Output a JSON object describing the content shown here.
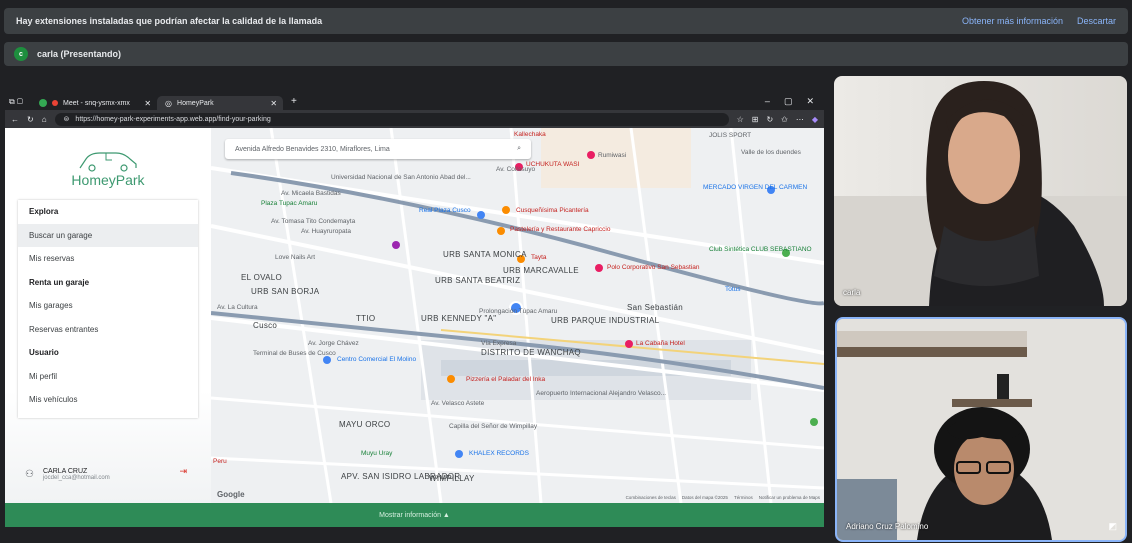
{
  "extension_bar": {
    "message": "Hay extensiones instaladas que podrían afectar la calidad de la llamada",
    "more_info": "Obtener más información",
    "dismiss": "Descartar"
  },
  "presenting_bar": {
    "avatar_letter": "c",
    "label": "carla (Presentando)"
  },
  "browser": {
    "tabs": [
      {
        "label": "Meet - snq-ysmx-xmx",
        "close": "✕"
      },
      {
        "label": "HomeyPark",
        "close": "✕"
      }
    ],
    "new_tab": "+",
    "url": "https://homey-park-experiments-app.web.app/find-your-parking",
    "window_controls": [
      "–",
      "▢",
      "✕"
    ]
  },
  "app": {
    "brand": "HomeyPark",
    "brand_color": "#3d9970",
    "menu": [
      {
        "label": "Explora",
        "type": "header"
      },
      {
        "label": "Buscar un garage",
        "type": "item",
        "selected": true
      },
      {
        "label": "Mis reservas",
        "type": "item"
      },
      {
        "label": "Renta un garaje",
        "type": "header"
      },
      {
        "label": "Mis garages",
        "type": "item"
      },
      {
        "label": "Reservas entrantes",
        "type": "item"
      },
      {
        "label": "Usuario",
        "type": "header"
      },
      {
        "label": "Mi perfil",
        "type": "item"
      },
      {
        "label": "Mis vehículos",
        "type": "item"
      }
    ],
    "user": {
      "name": "CARLA CRUZ",
      "email": "jocdel_cca@hotmail.com"
    },
    "search_value": "Avenida Alfredo Benavides 2310, Miraflores, Lima",
    "show_info": "Mostrar información ▲"
  },
  "map": {
    "labels_big": [
      "EL OVALO",
      "URB SAN BORJA",
      "URB SANTA MONICA",
      "URB MARCAVALLE",
      "URB SANTA BEATRIZ",
      "URB KENNEDY \"A\"",
      "URB PARQUE INDUSTRIAL",
      "DISTRITO DE WANCHAQ",
      "MAYU ORCO",
      "APV. SAN ISIDRO LABRADOR",
      "WIMPILLAY",
      "San Sebastián",
      "Cusco",
      "TTIO"
    ],
    "pois": [
      "Kallechaka",
      "UCHUKUTA WASI",
      "Rumiwasi",
      "Real Plaza Cusco",
      "Cusqueñísima Picantería",
      "Pastelería y Restaurante Capriccio",
      "Tayta",
      "Polo Corporativo San Sebastian",
      "Centro Comercial El Molino",
      "Pizzería el Paladar del Inka",
      "Aeropuerto Internacional Alejandro Velasco...",
      "La Cabaña Hotel",
      "Capilla del Señor de Wimpillay",
      "KHALEX RECORDS",
      "Muyu Uray",
      "MERCADO VIRGEN DEL CARMEN",
      "Club Sintética CLUB SEBASTIANO",
      "Totus",
      "Terminal de Buses de Cusco",
      "Plaza Tupac Amaru",
      "Universidad Nacional de San Antonio Abad del...",
      "Love Nails Art",
      "JOLIS SPORT",
      "Valle de los duendes",
      "Peru"
    ],
    "roads": [
      "Av. Collasuyo",
      "Av. Micaela Bastidas",
      "Vía Expresa",
      "Av. Velasco Astete",
      "Prolongación Túpac Amaru",
      "Av. Jorge Chávez",
      "Av. Huayruropata",
      "Av. Tomasa Tito Condemayta",
      "Av. La Cultura"
    ],
    "google": "Google",
    "footer": [
      "Combinaciones de teclas",
      "Datos del mapa ©2025",
      "Términos",
      "Notificar un problema de Maps"
    ]
  },
  "participants": [
    {
      "name": "carla"
    },
    {
      "name": "Adriano Cruz Palomino"
    }
  ]
}
